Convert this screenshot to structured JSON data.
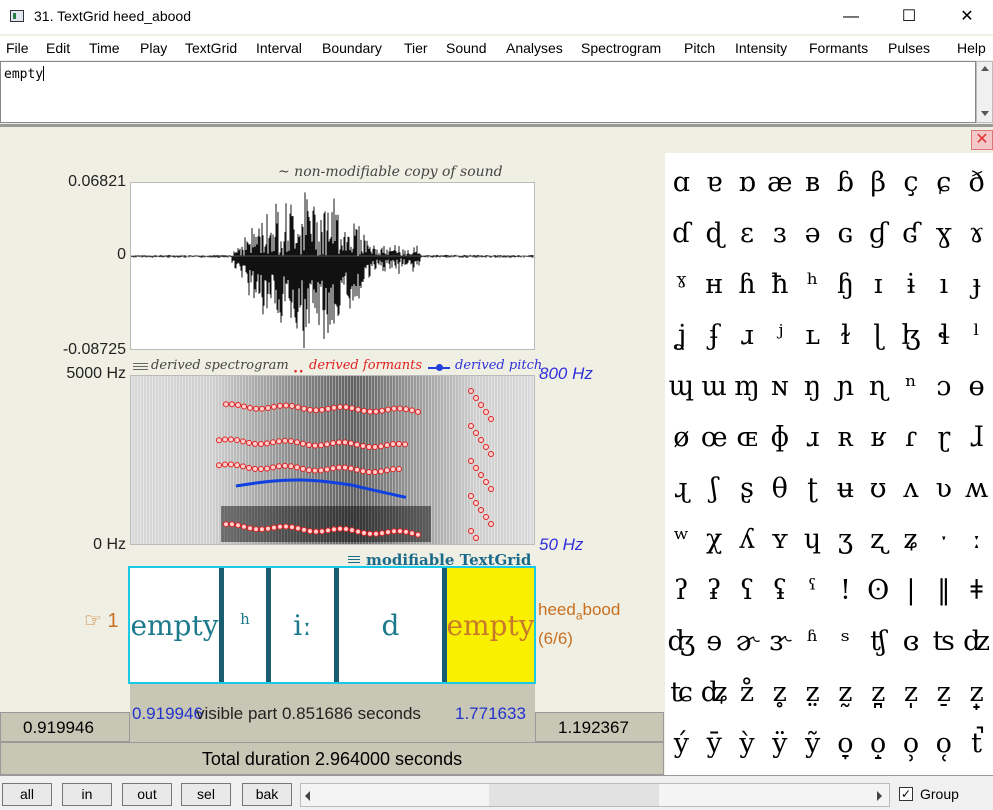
{
  "window": {
    "title": "31. TextGrid heed_abood",
    "minimize": "—",
    "maximize": "☐",
    "close": "✕"
  },
  "menu": [
    "File",
    "Edit",
    "Time",
    "Play",
    "TextGrid",
    "Interval",
    "Boundary",
    "Tier",
    "Sound",
    "Analyses",
    "Spectrogram",
    "Pitch",
    "Intensity",
    "Formants",
    "Pulses",
    "Help"
  ],
  "text_field": {
    "value": "empty"
  },
  "close_panel": "✕",
  "waveform": {
    "caption": "~ non-modifiable copy of sound",
    "y_max": "0.06821",
    "y_zero": "0",
    "y_min": "-0.08725"
  },
  "spectrogram": {
    "legend_spectrogram": "derived spectrogram",
    "legend_formants": "derived formants",
    "legend_pitch": "derived pitch",
    "freq_top": "5000 Hz",
    "freq_bottom": "0 Hz",
    "pitch_top": "800 Hz",
    "pitch_bottom": "50 Hz"
  },
  "textgrid": {
    "caption": "modifiable TextGrid",
    "tier_number": "☞ 1",
    "tier_name_main": "heed",
    "tier_name_sub": "a",
    "tier_name_rest": "bood",
    "tier_count": "(6/6)",
    "intervals": [
      {
        "label": "empty"
      },
      {
        "label": "h"
      },
      {
        "label": "iː"
      },
      {
        "label": "d"
      },
      {
        "label": "empty",
        "selected": true
      }
    ]
  },
  "selection": {
    "start": "0.919946",
    "end": "1.771633",
    "visible_part": "visible part 0.851686 seconds"
  },
  "times": {
    "left": "0.919946",
    "right": "1.192367",
    "total": "Total duration 2.964000 seconds"
  },
  "ipa_rows": [
    [
      "ɑ",
      "ɐ",
      "ɒ",
      "æ",
      "ʙ",
      "ɓ",
      "β",
      "ç",
      "ɕ",
      "ð"
    ],
    [
      "ɗ",
      "ɖ",
      "ɛ",
      "ɜ",
      "ə",
      "ɢ",
      "ɠ",
      "ʛ",
      "ɣ",
      "ɤ"
    ],
    [
      "ˠ",
      "ʜ",
      "ɦ",
      "ħ",
      "ʰ",
      "ɧ",
      "ɪ",
      "ɨ",
      "ı",
      "ɟ"
    ],
    [
      "ʝ",
      "ʄ",
      "ɹ",
      "ʲ",
      "ʟ",
      "ɫ",
      "ɭ",
      "ɮ",
      "ɬ",
      "ˡ"
    ],
    [
      "ɰ",
      "ɯ",
      "ɱ",
      "ɴ",
      "ŋ",
      "ɲ",
      "ɳ",
      "ⁿ",
      "ɔ",
      "ɵ"
    ],
    [
      "ø",
      "œ",
      "ɶ",
      "ɸ",
      "ɹ",
      "ʀ",
      "ʁ",
      "ɾ",
      "ɽ",
      "ɺ"
    ],
    [
      "ɻ",
      "ʃ",
      "ʂ",
      "θ",
      "ʈ",
      "ʉ",
      "ʊ",
      "ʌ",
      "ʋ",
      "ʍ"
    ],
    [
      "ʷ",
      "χ",
      "ʎ",
      "ʏ",
      "ɥ",
      "ʒ",
      "ʐ",
      "ʑ",
      "ˑ",
      "ː"
    ],
    [
      "ʔ",
      "ʡ",
      "ʕ",
      "ʢ",
      "ˤ",
      "!",
      "ʘ",
      "|",
      "‖",
      "ǂ"
    ],
    [
      "ʤ",
      "ɘ",
      "ɚ",
      "ɝ",
      "ʱ",
      "ˢ",
      "ʧ",
      "ɞ",
      "ʦ",
      "ʣ"
    ],
    [
      "ʨ",
      "ʥ",
      "z̊",
      "z̥",
      "z̤",
      "z̰",
      "z̪",
      "z̩",
      "z̠",
      "z̟"
    ],
    [
      "ý",
      "ȳ",
      "ỳ",
      "ÿ",
      "ỹ",
      "o̞",
      "o̝",
      "o̹",
      "o̜",
      "t̚"
    ]
  ],
  "buttons": {
    "all": "all",
    "in": "in",
    "out": "out",
    "sel": "sel",
    "bak": "bak"
  },
  "group": {
    "label": "Group",
    "checked": true,
    "mark": "✓"
  },
  "colors": {
    "selection_fill": "#f9f000",
    "tier_border": "#19c9e6",
    "formant": "#e02020",
    "pitch": "#1040e0"
  }
}
